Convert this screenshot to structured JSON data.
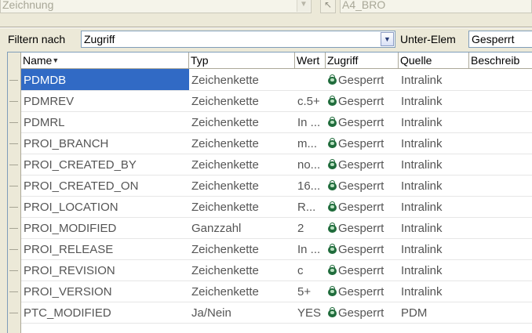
{
  "top": {
    "drawing_combo": "Zeichnung",
    "format_combo": "A4_BRO"
  },
  "filter": {
    "label": "Filtern nach",
    "value": "Zugriff",
    "sub_label": "Unter-Elem",
    "sub_value": "Gesperrt"
  },
  "columns": {
    "name": "Name",
    "typ": "Typ",
    "wert": "Wert",
    "zugriff": "Zugriff",
    "quelle": "Quelle",
    "beschreib": "Beschreib"
  },
  "rows": [
    {
      "name": "PDMDB",
      "typ": "Zeichenkette",
      "wert": "",
      "zugriff": "Gesperrt",
      "quelle": "Intralink",
      "selected": true
    },
    {
      "name": "PDMREV",
      "typ": "Zeichenkette",
      "wert": "c.5+",
      "zugriff": "Gesperrt",
      "quelle": "Intralink"
    },
    {
      "name": "PDMRL",
      "typ": "Zeichenkette",
      "wert": "In ...",
      "zugriff": "Gesperrt",
      "quelle": "Intralink"
    },
    {
      "name": "PROI_BRANCH",
      "typ": "Zeichenkette",
      "wert": "m...",
      "zugriff": "Gesperrt",
      "quelle": "Intralink"
    },
    {
      "name": "PROI_CREATED_BY",
      "typ": "Zeichenkette",
      "wert": "no...",
      "zugriff": "Gesperrt",
      "quelle": "Intralink"
    },
    {
      "name": "PROI_CREATED_ON",
      "typ": "Zeichenkette",
      "wert": "16...",
      "zugriff": "Gesperrt",
      "quelle": "Intralink"
    },
    {
      "name": "PROI_LOCATION",
      "typ": "Zeichenkette",
      "wert": "R...",
      "zugriff": "Gesperrt",
      "quelle": "Intralink"
    },
    {
      "name": "PROI_MODIFIED",
      "typ": "Ganzzahl",
      "wert": "2",
      "zugriff": "Gesperrt",
      "quelle": "Intralink"
    },
    {
      "name": "PROI_RELEASE",
      "typ": "Zeichenkette",
      "wert": "In ...",
      "zugriff": "Gesperrt",
      "quelle": "Intralink"
    },
    {
      "name": "PROI_REVISION",
      "typ": "Zeichenkette",
      "wert": "c",
      "zugriff": "Gesperrt",
      "quelle": "Intralink"
    },
    {
      "name": "PROI_VERSION",
      "typ": "Zeichenkette",
      "wert": "5+",
      "zugriff": "Gesperrt",
      "quelle": "Intralink"
    },
    {
      "name": "PTC_MODIFIED",
      "typ": "Ja/Nein",
      "wert": "YES",
      "zugriff": "Gesperrt",
      "quelle": "PDM"
    }
  ]
}
